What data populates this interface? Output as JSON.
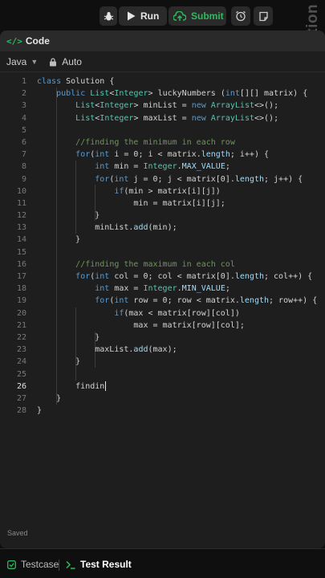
{
  "toolbar": {
    "run_label": "Run",
    "submit_label": "Submit",
    "watermark": "@AlgoXploration"
  },
  "editor": {
    "title": "Code",
    "language": "Java",
    "mode": "Auto",
    "status": "Saved"
  },
  "bottom_tabs": {
    "testcase": "Testcase",
    "test_result": "Test Result"
  },
  "colors": {
    "accent_green": "#2cbb5d",
    "keyword": "#569cd6",
    "type": "#4ec9b0",
    "comment": "#6a9955",
    "string": "#ce9178"
  },
  "code_lines": [
    {
      "n": "1",
      "text": "class Solution {"
    },
    {
      "n": "2",
      "text": "    public List<Integer> luckyNumbers (int[][] matrix) {"
    },
    {
      "n": "3",
      "text": "        List<Integer> minList = new ArrayList<>();"
    },
    {
      "n": "4",
      "text": "        List<Integer> maxList = new ArrayList<>();"
    },
    {
      "n": "5",
      "text": ""
    },
    {
      "n": "6",
      "text": "        //finding the minimum in each row"
    },
    {
      "n": "7",
      "text": "        for(int i = 0; i < matrix.length; i++) {"
    },
    {
      "n": "8",
      "text": "            int min = Integer.MAX_VALUE;"
    },
    {
      "n": "9",
      "text": "            for(int j = 0; j < matrix[0].length; j++) {"
    },
    {
      "n": "10",
      "text": "                if(min > matrix[i][j])"
    },
    {
      "n": "11",
      "text": "                    min = matrix[i][j];"
    },
    {
      "n": "12",
      "text": "            }"
    },
    {
      "n": "13",
      "text": "            minList.add(min);"
    },
    {
      "n": "14",
      "text": "        }"
    },
    {
      "n": "15",
      "text": ""
    },
    {
      "n": "16",
      "text": "        //finding the maximum in each col"
    },
    {
      "n": "17",
      "text": "        for(int col = 0; col < matrix[0].length; col++) {"
    },
    {
      "n": "18",
      "text": "            int max = Integer.MIN_VALUE;"
    },
    {
      "n": "19",
      "text": "            for(int row = 0; row < matrix.length; row++) {"
    },
    {
      "n": "20",
      "text": "                if(max < matrix[row][col])"
    },
    {
      "n": "21",
      "text": "                    max = matrix[row][col];"
    },
    {
      "n": "22",
      "text": "            }"
    },
    {
      "n": "23",
      "text": "            maxList.add(max);"
    },
    {
      "n": "24",
      "text": "        }"
    },
    {
      "n": "25",
      "text": ""
    },
    {
      "n": "26",
      "text": "        findin"
    },
    {
      "n": "27",
      "text": "    }"
    },
    {
      "n": "28",
      "text": "}"
    }
  ],
  "cursor_line": "26"
}
